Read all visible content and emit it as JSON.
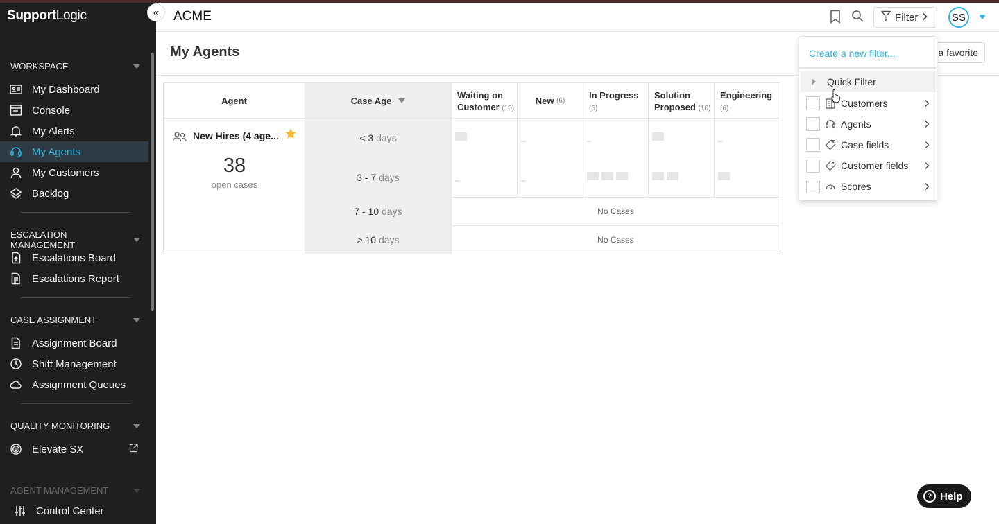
{
  "app": {
    "brand_bold": "Support",
    "brand_light": "Logic",
    "collapse_glyph": "«"
  },
  "sidebar": {
    "workspace_label": "WORKSPACE",
    "workspace_items": [
      {
        "label": "My Dashboard",
        "icon": "id-card-icon"
      },
      {
        "label": "Console",
        "icon": "window-icon"
      },
      {
        "label": "My Alerts",
        "icon": "bell-icon"
      },
      {
        "label": "My Agents",
        "icon": "headset-icon",
        "active": true
      },
      {
        "label": "My Customers",
        "icon": "person-icon"
      },
      {
        "label": "Backlog",
        "icon": "stack-icon"
      }
    ],
    "escalation_label": "ESCALATION MANAGEMENT",
    "escalation_items": [
      {
        "label": "Escalations Board",
        "icon": "doc-up-icon"
      },
      {
        "label": "Escalations Report",
        "icon": "doc-report-icon"
      }
    ],
    "assignment_label": "CASE ASSIGNMENT",
    "assignment_items": [
      {
        "label": "Assignment Board",
        "icon": "doc-list-icon"
      },
      {
        "label": "Shift Management",
        "icon": "clock-icon"
      },
      {
        "label": "Assignment Queues",
        "icon": "cloud-icon"
      }
    ],
    "quality_label": "QUALITY MONITORING",
    "quality_items": [
      {
        "label": "Elevate SX",
        "icon": "target-icon"
      }
    ],
    "agent_mgmt_label": "AGENT MANAGEMENT",
    "agent_mgmt_items": [
      {
        "label": "Control Center",
        "icon": "sliders-icon"
      }
    ]
  },
  "topbar": {
    "org": "ACME",
    "filter_label": "Filter",
    "avatar_initials": "SS"
  },
  "page": {
    "title": "My Agents",
    "favorite_label": "l a favorite"
  },
  "table": {
    "col_agent": "Agent",
    "col_case_age": "Case Age",
    "columns": [
      {
        "label_l1": "Waiting on",
        "label_l2": "Customer",
        "count": "(10)"
      },
      {
        "label_l1": "New",
        "label_l2": "",
        "count": "(6)"
      },
      {
        "label_l1": "In Progress",
        "label_l2": "",
        "count": "(6)"
      },
      {
        "label_l1": "Solution",
        "label_l2": "Proposed",
        "count": "(10)"
      },
      {
        "label_l1": "Engineering",
        "label_l2": "",
        "count": "(6)"
      }
    ],
    "group_name": "New Hires (4 age...",
    "open_count": "38",
    "open_label": "open cases",
    "ages": [
      {
        "range": "< 3",
        "unit": "days"
      },
      {
        "range": "3 - 7",
        "unit": "days"
      },
      {
        "range": "7 - 10",
        "unit": "days"
      },
      {
        "range": "> 10",
        "unit": "days"
      }
    ],
    "dash_glyph": "–",
    "no_cases": "No Cases"
  },
  "filter_menu": {
    "create": "Create a new filter...",
    "quick": "Quick Filter",
    "items": [
      {
        "label": "Customers",
        "icon": "building-icon"
      },
      {
        "label": "Agents",
        "icon": "headset-icon"
      },
      {
        "label": "Case fields",
        "icon": "tag-icon"
      },
      {
        "label": "Customer fields",
        "icon": "tag-icon"
      },
      {
        "label": "Scores",
        "icon": "gauge-icon"
      }
    ]
  },
  "help": {
    "label": "Help",
    "glyph": "?"
  },
  "colors": {
    "accent": "#33b3dc",
    "sidebar_bg": "#1f1f1f",
    "star": "#f5b932"
  }
}
